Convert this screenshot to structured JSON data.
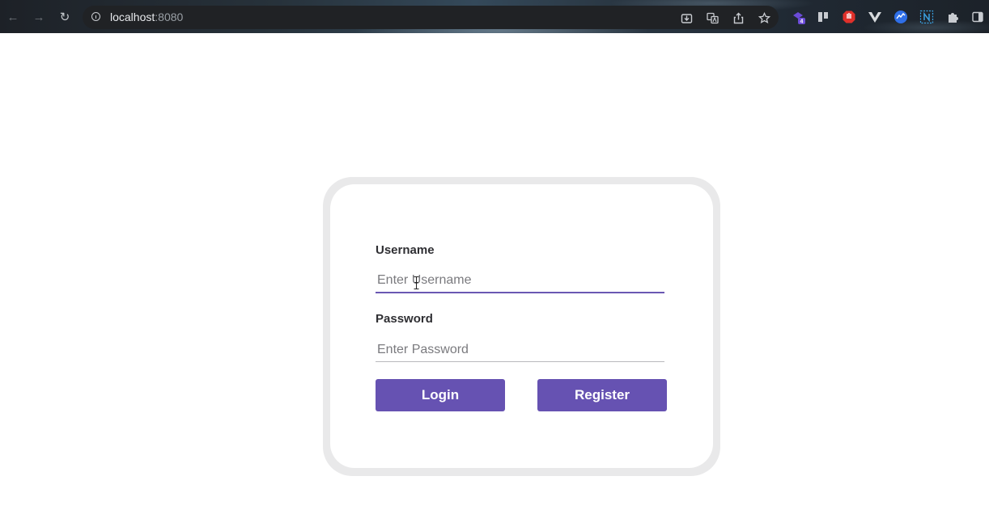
{
  "browser": {
    "url_host": "localhost",
    "url_port": ":8080",
    "extension_badge": "4"
  },
  "form": {
    "username_label": "Username",
    "username_placeholder": "Enter Username",
    "username_value": "",
    "password_label": "Password",
    "password_placeholder": "Enter Password",
    "password_value": "",
    "login_label": "Login",
    "register_label": "Register"
  },
  "colors": {
    "accent": "#6652b2",
    "card_border": "#e9e9ea"
  }
}
